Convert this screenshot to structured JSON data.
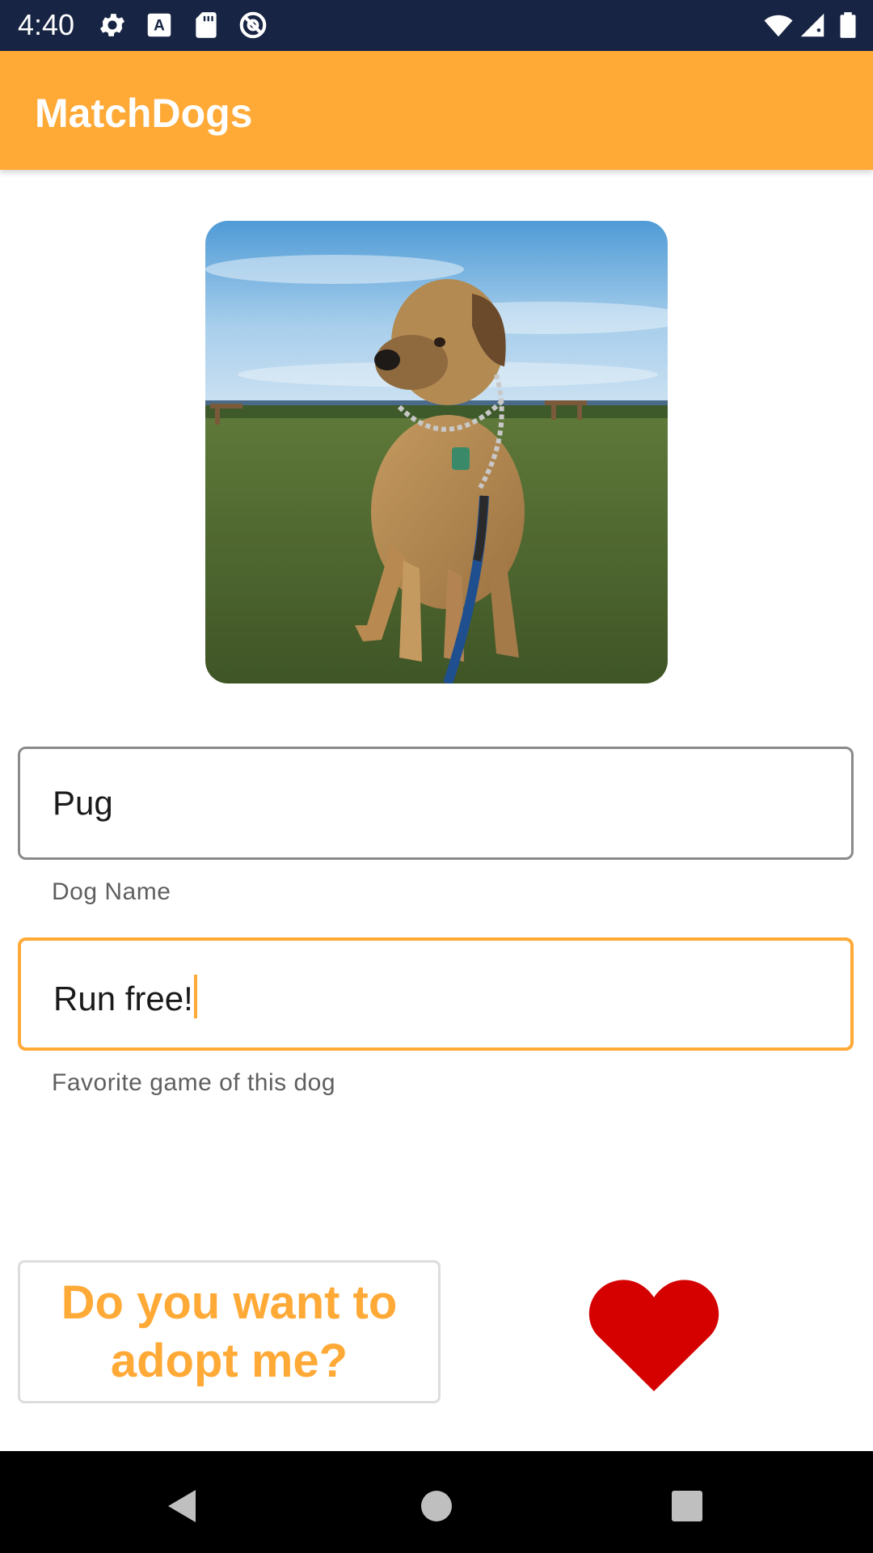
{
  "status_bar": {
    "time": "4:40",
    "left_icons": [
      "gear-icon",
      "keyboard-a-icon",
      "sd-card-icon",
      "do-not-disturb-icon"
    ],
    "right_icons": [
      "wifi-icon",
      "signal-icon",
      "battery-icon"
    ]
  },
  "app_bar": {
    "title": "MatchDogs",
    "background": "#ffa937"
  },
  "dog_photo": {
    "subject": "dog-photo"
  },
  "name_field": {
    "value": "Pug",
    "helper": "Dog Name"
  },
  "game_field": {
    "value": "Run free!",
    "helper": "Favorite game of this dog",
    "focused": true,
    "accent": "#ffa937"
  },
  "adopt_button": {
    "label": "Do you want to adopt me?",
    "color": "#ffa937"
  },
  "heart": {
    "icon": "heart-icon",
    "color": "#d50000"
  },
  "nav_bar": {
    "buttons": [
      "back-icon",
      "home-icon",
      "recents-icon"
    ]
  }
}
